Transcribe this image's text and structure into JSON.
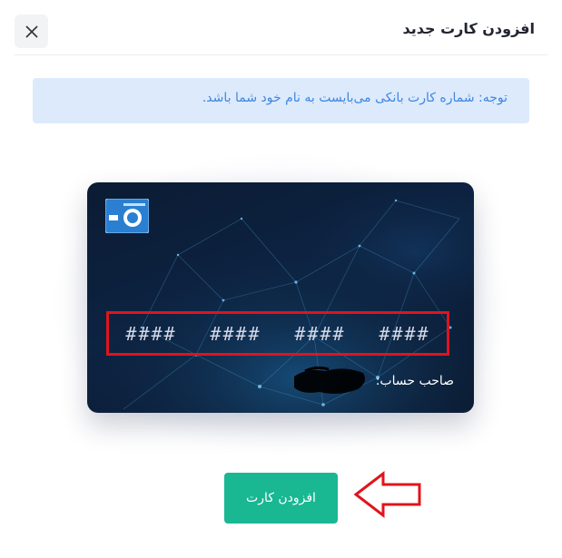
{
  "header": {
    "title": "افزودن کارت جدید"
  },
  "notice": {
    "text": "توجه: شماره کارت بانکی می‌بایست به نام خود شما باشد."
  },
  "card": {
    "number_groups": [
      "####",
      "####",
      "####",
      "####"
    ],
    "holder_label": "صاحب حساب:"
  },
  "actions": {
    "add_card_label": "افزودن کارت"
  },
  "colors": {
    "accent": "#19b792",
    "notice_bg": "#ddeafc",
    "notice_text": "#3d86e2",
    "highlight": "#e0141c"
  }
}
